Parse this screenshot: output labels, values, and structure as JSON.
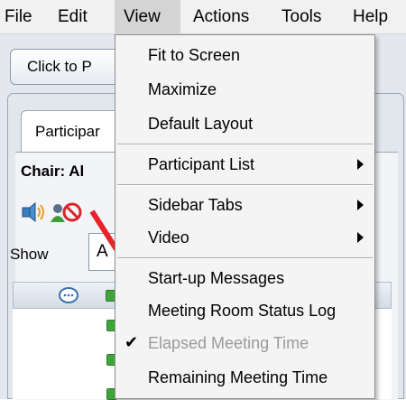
{
  "menubar": {
    "items": [
      "File",
      "Edit",
      "View",
      "Actions",
      "Tools",
      "Help"
    ]
  },
  "toolbar": {
    "button_label": "Click to P"
  },
  "panel": {
    "tab_label": "Participar",
    "chair_label": "Chair: Al",
    "show_label": "Show",
    "show_value": "A"
  },
  "view_menu": {
    "items": [
      {
        "label": "Fit to Screen"
      },
      {
        "label": "Maximize"
      },
      {
        "label": "Default Layout"
      },
      {
        "label": "Participant List"
      },
      {
        "label": "Sidebar Tabs"
      },
      {
        "label": "Video"
      },
      {
        "label": "Start-up Messages"
      },
      {
        "label": "Meeting Room Status Log"
      },
      {
        "label": "Elapsed Meeting Time"
      },
      {
        "label": "Remaining Meeting Time"
      }
    ]
  },
  "colors": {
    "annotation_arrow": "#e8242a",
    "status_green": "#3fa53a",
    "menu_background": "#f4f4f4"
  },
  "icons": [
    "speaker-icon",
    "user-icon",
    "no-symbol-icon",
    "chat-icon",
    "check-icon",
    "submenu-arrow-icon"
  ]
}
